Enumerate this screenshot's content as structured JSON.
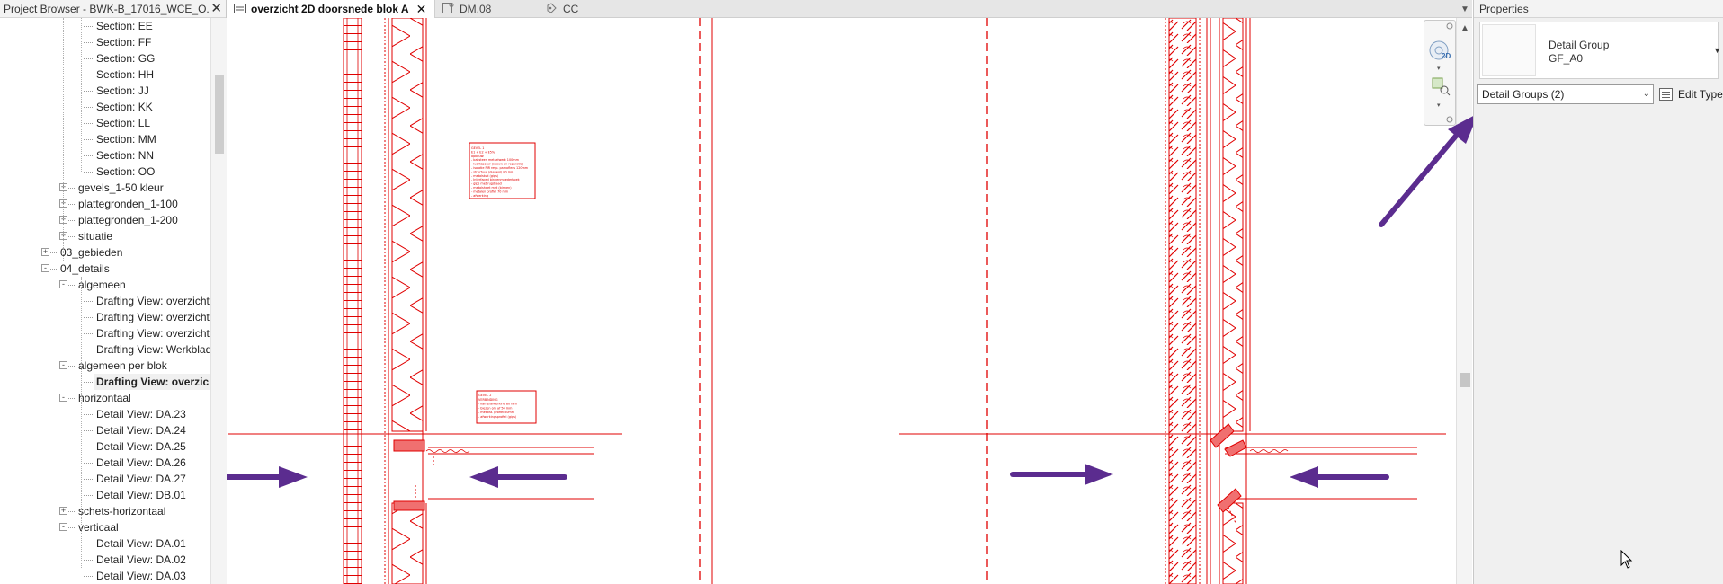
{
  "project_browser": {
    "title": "Project Browser - BWK-B_17016_WCE_O...",
    "items": [
      {
        "label": "Section: EE",
        "depth": 3,
        "toggle": ""
      },
      {
        "label": "Section: FF",
        "depth": 3,
        "toggle": ""
      },
      {
        "label": "Section: GG",
        "depth": 3,
        "toggle": ""
      },
      {
        "label": "Section: HH",
        "depth": 3,
        "toggle": ""
      },
      {
        "label": "Section: JJ",
        "depth": 3,
        "toggle": ""
      },
      {
        "label": "Section: KK",
        "depth": 3,
        "toggle": ""
      },
      {
        "label": "Section: LL",
        "depth": 3,
        "toggle": ""
      },
      {
        "label": "Section: MM",
        "depth": 3,
        "toggle": ""
      },
      {
        "label": "Section: NN",
        "depth": 3,
        "toggle": ""
      },
      {
        "label": "Section: OO",
        "depth": 3,
        "toggle": ""
      },
      {
        "label": "gevels_1-50 kleur",
        "depth": 2,
        "toggle": "+"
      },
      {
        "label": "plattegronden_1-100",
        "depth": 2,
        "toggle": "+"
      },
      {
        "label": "plattegronden_1-200",
        "depth": 2,
        "toggle": "+"
      },
      {
        "label": "situatie",
        "depth": 2,
        "toggle": "+"
      },
      {
        "label": "03_gebieden",
        "depth": 1,
        "toggle": "+"
      },
      {
        "label": "04_details",
        "depth": 1,
        "toggle": "-"
      },
      {
        "label": "algemeen",
        "depth": 2,
        "toggle": "-"
      },
      {
        "label": "Drafting View: overzicht",
        "depth": 3,
        "toggle": ""
      },
      {
        "label": "Drafting View: overzicht",
        "depth": 3,
        "toggle": ""
      },
      {
        "label": "Drafting View: overzicht",
        "depth": 3,
        "toggle": ""
      },
      {
        "label": "Drafting View: Werkblad",
        "depth": 3,
        "toggle": ""
      },
      {
        "label": "algemeen per blok",
        "depth": 2,
        "toggle": "-"
      },
      {
        "label": "Drafting View: overzic",
        "depth": 3,
        "toggle": "",
        "selected": true
      },
      {
        "label": "horizontaal",
        "depth": 2,
        "toggle": "-"
      },
      {
        "label": "Detail View: DA.23",
        "depth": 3,
        "toggle": ""
      },
      {
        "label": "Detail View: DA.24",
        "depth": 3,
        "toggle": ""
      },
      {
        "label": "Detail View: DA.25",
        "depth": 3,
        "toggle": ""
      },
      {
        "label": "Detail View: DA.26",
        "depth": 3,
        "toggle": ""
      },
      {
        "label": "Detail View: DA.27",
        "depth": 3,
        "toggle": ""
      },
      {
        "label": "Detail View: DB.01",
        "depth": 3,
        "toggle": ""
      },
      {
        "label": "schets-horizontaal",
        "depth": 2,
        "toggle": "+"
      },
      {
        "label": "verticaal",
        "depth": 2,
        "toggle": "-"
      },
      {
        "label": "Detail View: DA.01",
        "depth": 3,
        "toggle": ""
      },
      {
        "label": "Detail View: DA.02",
        "depth": 3,
        "toggle": ""
      },
      {
        "label": "Detail View: DA.03",
        "depth": 3,
        "toggle": ""
      }
    ]
  },
  "tabs": [
    {
      "label": "overzicht 2D doorsnede blok A",
      "active": true,
      "icon": "drafting-view-icon"
    },
    {
      "label": "DM.08",
      "active": false,
      "icon": "sheet-icon"
    },
    {
      "label": "CC",
      "active": false,
      "icon": "section-icon"
    }
  ],
  "properties": {
    "title": "Properties",
    "type_family": "Detail Group",
    "type_name": "GF_A0",
    "filter_value": "Detail Groups (2)",
    "edit_type_label": "Edit Type"
  },
  "colors": {
    "drawing_red": "#e00000",
    "arrow_purple": "#5b2c8f"
  },
  "canvas_annotations": {
    "box1_lines": [
      "GEVEL 1",
      "E1 + E2 + E5%",
      "opbouw:",
      "- baksteen metselwerk 100mm",
      "- luchtspouw (spouw en reparatie)",
      "- isolatie PIR resp. pamoflecs 120mm",
      "- structuur (glaswol) 80 mm",
      "- metalstud (gips)",
      "- Interfaced binnenmoederhoek",
      "- gips met rugdraad",
      "- metalsheet met (binnen)",
      "- metalen profiel 70 mm",
      "- afwerking"
    ],
    "box2_lines": [
      "GEVEL 2",
      "VERBINDING",
      "- kamerafwerking 80 mm",
      "- biezen om af 50 mm",
      "- metalst. profiel 50mm",
      "- afwerkingsprofiel (gips)"
    ]
  }
}
